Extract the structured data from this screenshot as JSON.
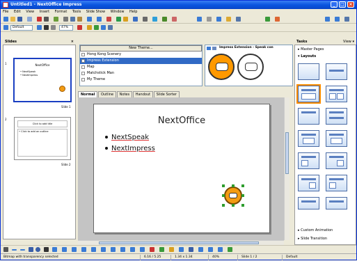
{
  "window": {
    "title": "Untitled1 - NextOffice Impress",
    "min": "_",
    "max": "□",
    "close": "×"
  },
  "menu": [
    "File",
    "Edit",
    "View",
    "Insert",
    "Format",
    "Tools",
    "Slide Show",
    "Window",
    "Help"
  ],
  "format_bar": {
    "style_value": "Default",
    "zoom": "47%"
  },
  "slides_panel": {
    "header": "Slides",
    "close": "×",
    "slide1_label": "Slide 1",
    "slide1_title": "NextOffice",
    "slide1_bullets": [
      "• NextSpeak",
      "• NextImpress"
    ],
    "slide2_label": "Slide 2",
    "slide2_title": "Click to add title",
    "slide2_text": "• Click to add an outline",
    "num1": "1",
    "num2": "2"
  },
  "theme_panel": {
    "new_theme_label": "New Theme...",
    "themes": [
      "Hong Kong Scenery",
      "Impress Extension",
      "Map",
      "Matchstick Man",
      "My Theme"
    ],
    "selected_index": 1,
    "extension_title": "Impress Extension - Speak con"
  },
  "view_tabs": [
    "Normal",
    "Outline",
    "Notes",
    "Handout",
    "Slide Sorter"
  ],
  "slide": {
    "title": "NextOffice",
    "bullets": [
      "NextSpeak",
      "NextImpress"
    ]
  },
  "tasks_panel": {
    "header": "Tasks",
    "view_label": "View ▾",
    "master_pages": "▸ Master Pages",
    "layouts": "▾ Layouts",
    "custom_animation": "▸ Custom Animation",
    "slide_transition": "▸ Slide Transition"
  },
  "status": {
    "message": "Bitmap with transparency selected",
    "position": "6.16 / 5.25",
    "size": "1.34 x 1.34",
    "zoom": "40%",
    "slide": "Slide 1 / 2",
    "layout": "Default"
  },
  "colors": {
    "accent": "#0a55e0",
    "selection": "#316ac5",
    "orange": "#ff9900"
  }
}
